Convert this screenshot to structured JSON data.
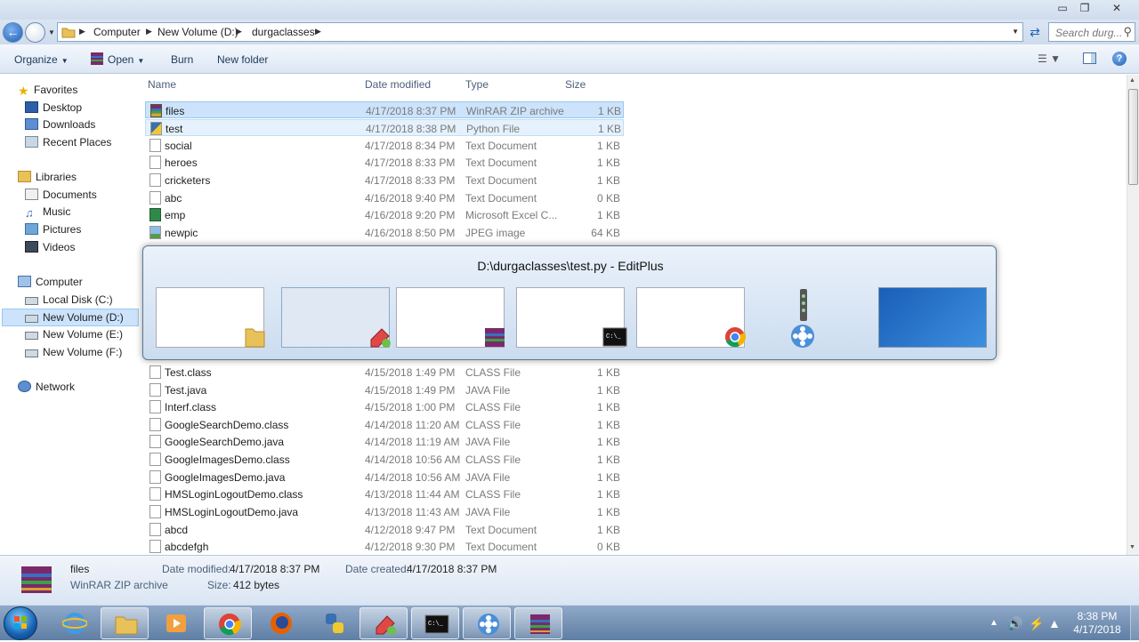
{
  "window": {
    "minimize": "▭",
    "maximize": "❐",
    "close": "✕"
  },
  "address": {
    "crumbs": [
      "Computer",
      "New Volume (D:)",
      "durgaclasses"
    ],
    "search_placeholder": "Search durg..."
  },
  "toolbar": {
    "organize": "Organize",
    "open": "Open",
    "burn": "Burn",
    "new_folder": "New folder"
  },
  "nav": {
    "favorites": "Favorites",
    "desktop": "Desktop",
    "downloads": "Downloads",
    "recent": "Recent Places",
    "libraries": "Libraries",
    "documents": "Documents",
    "music": "Music",
    "pictures": "Pictures",
    "videos": "Videos",
    "computer": "Computer",
    "c": "Local Disk (C:)",
    "d": "New Volume (D:)",
    "e": "New Volume (E:)",
    "f": "New Volume (F:)",
    "network": "Network"
  },
  "columns": {
    "name": "Name",
    "date": "Date modified",
    "type": "Type",
    "size": "Size"
  },
  "files": [
    {
      "name": "files",
      "date": "4/17/2018 8:37 PM",
      "type": "WinRAR ZIP archive",
      "size": "1 KB",
      "icon": "winrar-icon"
    },
    {
      "name": "test",
      "date": "4/17/2018 8:38 PM",
      "type": "Python File",
      "size": "1 KB",
      "icon": "python-icon"
    },
    {
      "name": "social",
      "date": "4/17/2018 8:34 PM",
      "type": "Text Document",
      "size": "1 KB",
      "icon": "text-file-icon"
    },
    {
      "name": "heroes",
      "date": "4/17/2018 8:33 PM",
      "type": "Text Document",
      "size": "1 KB",
      "icon": "text-file-icon"
    },
    {
      "name": "cricketers",
      "date": "4/17/2018 8:33 PM",
      "type": "Text Document",
      "size": "1 KB",
      "icon": "text-file-icon"
    },
    {
      "name": "abc",
      "date": "4/16/2018 9:40 PM",
      "type": "Text Document",
      "size": "0 KB",
      "icon": "text-file-icon"
    },
    {
      "name": "emp",
      "date": "4/16/2018 9:20 PM",
      "type": "Microsoft Excel C...",
      "size": "1 KB",
      "icon": "excel-icon"
    },
    {
      "name": "newpic",
      "date": "4/16/2018 8:50 PM",
      "type": "JPEG image",
      "size": "64 KB",
      "icon": "image-icon"
    },
    {
      "name": "Test.class",
      "date": "4/15/2018 1:49 PM",
      "type": "CLASS File",
      "size": "1 KB",
      "icon": "file-icon"
    },
    {
      "name": "Test.java",
      "date": "4/15/2018 1:49 PM",
      "type": "JAVA File",
      "size": "1 KB",
      "icon": "file-icon"
    },
    {
      "name": "Interf.class",
      "date": "4/15/2018 1:00 PM",
      "type": "CLASS File",
      "size": "1 KB",
      "icon": "file-icon"
    },
    {
      "name": "GoogleSearchDemo.class",
      "date": "4/14/2018 11:20 AM",
      "type": "CLASS File",
      "size": "1 KB",
      "icon": "file-icon"
    },
    {
      "name": "GoogleSearchDemo.java",
      "date": "4/14/2018 11:19 AM",
      "type": "JAVA File",
      "size": "1 KB",
      "icon": "file-icon"
    },
    {
      "name": "GoogleImagesDemo.class",
      "date": "4/14/2018 10:56 AM",
      "type": "CLASS File",
      "size": "1 KB",
      "icon": "file-icon"
    },
    {
      "name": "GoogleImagesDemo.java",
      "date": "4/14/2018 10:56 AM",
      "type": "JAVA File",
      "size": "1 KB",
      "icon": "file-icon"
    },
    {
      "name": "HMSLoginLogoutDemo.class",
      "date": "4/13/2018 11:44 AM",
      "type": "CLASS File",
      "size": "1 KB",
      "icon": "file-icon"
    },
    {
      "name": "HMSLoginLogoutDemo.java",
      "date": "4/13/2018 11:43 AM",
      "type": "JAVA File",
      "size": "1 KB",
      "icon": "file-icon"
    },
    {
      "name": "abcd",
      "date": "4/12/2018 9:47 PM",
      "type": "Text Document",
      "size": "1 KB",
      "icon": "text-file-icon"
    },
    {
      "name": "abcdefgh",
      "date": "4/12/2018 9:30 PM",
      "type": "Text Document",
      "size": "0 KB",
      "icon": "text-file-icon"
    }
  ],
  "details": {
    "name": "files",
    "type": "WinRAR ZIP archive",
    "modified_label": "Date modified:",
    "modified": "4/17/2018 8:37 PM",
    "created_label": "Date created:",
    "created": "4/17/2018 8:37 PM",
    "size_label": "Size:",
    "size": "412 bytes"
  },
  "switcher": {
    "title": "D:\\durgaclasses\\test.py - EditPlus"
  },
  "clock": {
    "time": "8:38 PM",
    "date": "4/17/2018"
  },
  "colors": {
    "selection": "#cce3fb",
    "accent": "#1b5fb8",
    "taskbar": "#6d8bb0"
  }
}
